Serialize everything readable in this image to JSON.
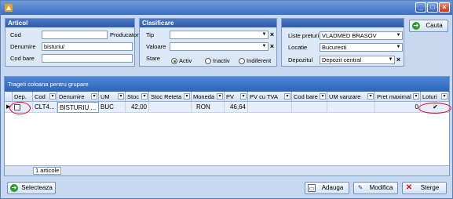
{
  "window": {
    "app_icon": "app-logo-icon",
    "controls": [
      "_",
      "□",
      "×"
    ]
  },
  "articol": {
    "title": "Articol",
    "cod_label": "Cod",
    "cod_value": "",
    "producator_label": "Producator",
    "denumire_label": "Denumire",
    "denumire_value": "bisturiu/",
    "cod_bare_label": "Cod bare",
    "cod_bare_value": ""
  },
  "clasificare": {
    "title": "Clasificare",
    "tip_label": "Tip",
    "tip_value": "",
    "valoare_label": "Valoare",
    "valoare_value": "",
    "stare_label": "Stare",
    "stare_options": [
      "Activ",
      "Inactiv",
      "Indiferent"
    ],
    "stare_selected": "Activ"
  },
  "locatie": {
    "liste_preturi_label": "Liste preturi",
    "liste_preturi_value": "VLADMED BRASOV",
    "locatie_label": "Locatie",
    "locatie_value": "Bucuresti",
    "depozitul_label": "Depozitul",
    "depozitul_value": "Depozit central"
  },
  "cauta_label": "Cauta",
  "grid": {
    "group_hint": "Trageti coloana pentru grupare",
    "columns": [
      "Dep.",
      "Cod",
      "Denumire",
      "UM",
      "Stoc",
      "Stoc Reteta",
      "Moneda",
      "PV",
      "PV cu TVA",
      "Cod bare",
      "UM vanzare",
      "Pret maximal",
      "Loturi"
    ],
    "rows": [
      {
        "dep": "",
        "cod": "CLT4...",
        "denumire": "BISTURIU ...",
        "um": "BUC",
        "stoc": "42,00",
        "stoc_reteta": "",
        "moneda": "RON",
        "pv": "46,64",
        "pv_tva": "",
        "cod_bare": "",
        "um_vanzare": "",
        "pret_maximal": "0",
        "loturi": "✔"
      }
    ],
    "status": "1 articole"
  },
  "buttons": {
    "selecteaza": "Selecteaza",
    "adauga": "Adauga",
    "modifica": "Modifica",
    "sterge": "Sterge"
  },
  "colors": {
    "title_bar": "#3e6fc0",
    "group_header": "#2f5aa8",
    "grid_group_bar": "#2e64b8",
    "highlight_circle": "#e0001a"
  }
}
